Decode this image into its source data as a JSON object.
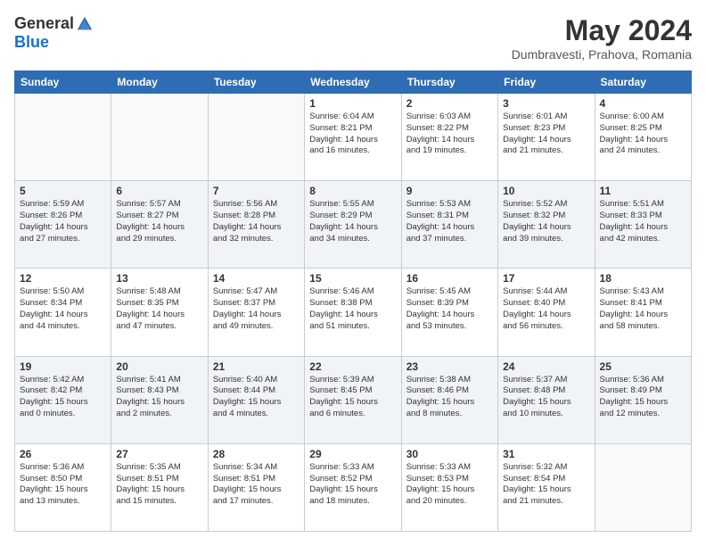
{
  "logo": {
    "general": "General",
    "blue": "Blue"
  },
  "title": "May 2024",
  "location": "Dumbravesti, Prahova, Romania",
  "days_of_week": [
    "Sunday",
    "Monday",
    "Tuesday",
    "Wednesday",
    "Thursday",
    "Friday",
    "Saturday"
  ],
  "weeks": [
    [
      {
        "day": "",
        "info": ""
      },
      {
        "day": "",
        "info": ""
      },
      {
        "day": "",
        "info": ""
      },
      {
        "day": "1",
        "info": "Sunrise: 6:04 AM\nSunset: 8:21 PM\nDaylight: 14 hours\nand 16 minutes."
      },
      {
        "day": "2",
        "info": "Sunrise: 6:03 AM\nSunset: 8:22 PM\nDaylight: 14 hours\nand 19 minutes."
      },
      {
        "day": "3",
        "info": "Sunrise: 6:01 AM\nSunset: 8:23 PM\nDaylight: 14 hours\nand 21 minutes."
      },
      {
        "day": "4",
        "info": "Sunrise: 6:00 AM\nSunset: 8:25 PM\nDaylight: 14 hours\nand 24 minutes."
      }
    ],
    [
      {
        "day": "5",
        "info": "Sunrise: 5:59 AM\nSunset: 8:26 PM\nDaylight: 14 hours\nand 27 minutes."
      },
      {
        "day": "6",
        "info": "Sunrise: 5:57 AM\nSunset: 8:27 PM\nDaylight: 14 hours\nand 29 minutes."
      },
      {
        "day": "7",
        "info": "Sunrise: 5:56 AM\nSunset: 8:28 PM\nDaylight: 14 hours\nand 32 minutes."
      },
      {
        "day": "8",
        "info": "Sunrise: 5:55 AM\nSunset: 8:29 PM\nDaylight: 14 hours\nand 34 minutes."
      },
      {
        "day": "9",
        "info": "Sunrise: 5:53 AM\nSunset: 8:31 PM\nDaylight: 14 hours\nand 37 minutes."
      },
      {
        "day": "10",
        "info": "Sunrise: 5:52 AM\nSunset: 8:32 PM\nDaylight: 14 hours\nand 39 minutes."
      },
      {
        "day": "11",
        "info": "Sunrise: 5:51 AM\nSunset: 8:33 PM\nDaylight: 14 hours\nand 42 minutes."
      }
    ],
    [
      {
        "day": "12",
        "info": "Sunrise: 5:50 AM\nSunset: 8:34 PM\nDaylight: 14 hours\nand 44 minutes."
      },
      {
        "day": "13",
        "info": "Sunrise: 5:48 AM\nSunset: 8:35 PM\nDaylight: 14 hours\nand 47 minutes."
      },
      {
        "day": "14",
        "info": "Sunrise: 5:47 AM\nSunset: 8:37 PM\nDaylight: 14 hours\nand 49 minutes."
      },
      {
        "day": "15",
        "info": "Sunrise: 5:46 AM\nSunset: 8:38 PM\nDaylight: 14 hours\nand 51 minutes."
      },
      {
        "day": "16",
        "info": "Sunrise: 5:45 AM\nSunset: 8:39 PM\nDaylight: 14 hours\nand 53 minutes."
      },
      {
        "day": "17",
        "info": "Sunrise: 5:44 AM\nSunset: 8:40 PM\nDaylight: 14 hours\nand 56 minutes."
      },
      {
        "day": "18",
        "info": "Sunrise: 5:43 AM\nSunset: 8:41 PM\nDaylight: 14 hours\nand 58 minutes."
      }
    ],
    [
      {
        "day": "19",
        "info": "Sunrise: 5:42 AM\nSunset: 8:42 PM\nDaylight: 15 hours\nand 0 minutes."
      },
      {
        "day": "20",
        "info": "Sunrise: 5:41 AM\nSunset: 8:43 PM\nDaylight: 15 hours\nand 2 minutes."
      },
      {
        "day": "21",
        "info": "Sunrise: 5:40 AM\nSunset: 8:44 PM\nDaylight: 15 hours\nand 4 minutes."
      },
      {
        "day": "22",
        "info": "Sunrise: 5:39 AM\nSunset: 8:45 PM\nDaylight: 15 hours\nand 6 minutes."
      },
      {
        "day": "23",
        "info": "Sunrise: 5:38 AM\nSunset: 8:46 PM\nDaylight: 15 hours\nand 8 minutes."
      },
      {
        "day": "24",
        "info": "Sunrise: 5:37 AM\nSunset: 8:48 PM\nDaylight: 15 hours\nand 10 minutes."
      },
      {
        "day": "25",
        "info": "Sunrise: 5:36 AM\nSunset: 8:49 PM\nDaylight: 15 hours\nand 12 minutes."
      }
    ],
    [
      {
        "day": "26",
        "info": "Sunrise: 5:36 AM\nSunset: 8:50 PM\nDaylight: 15 hours\nand 13 minutes."
      },
      {
        "day": "27",
        "info": "Sunrise: 5:35 AM\nSunset: 8:51 PM\nDaylight: 15 hours\nand 15 minutes."
      },
      {
        "day": "28",
        "info": "Sunrise: 5:34 AM\nSunset: 8:51 PM\nDaylight: 15 hours\nand 17 minutes."
      },
      {
        "day": "29",
        "info": "Sunrise: 5:33 AM\nSunset: 8:52 PM\nDaylight: 15 hours\nand 18 minutes."
      },
      {
        "day": "30",
        "info": "Sunrise: 5:33 AM\nSunset: 8:53 PM\nDaylight: 15 hours\nand 20 minutes."
      },
      {
        "day": "31",
        "info": "Sunrise: 5:32 AM\nSunset: 8:54 PM\nDaylight: 15 hours\nand 21 minutes."
      },
      {
        "day": "",
        "info": ""
      }
    ]
  ]
}
